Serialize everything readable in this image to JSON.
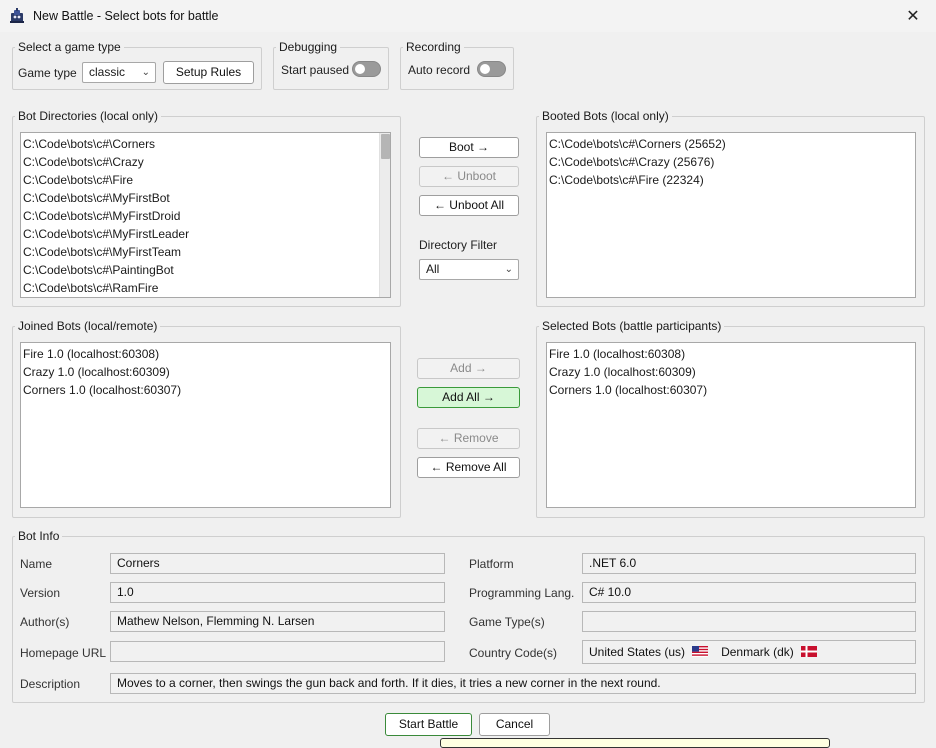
{
  "window": {
    "title": "New Battle - Select bots for battle",
    "icon": "robot-tank-icon",
    "close_icon": "close-icon"
  },
  "game_type": {
    "legend": "Select a game type",
    "label": "Game type",
    "selected": "classic",
    "setup_rules": "Setup Rules"
  },
  "debugging": {
    "legend": "Debugging",
    "label": "Start paused",
    "on": false
  },
  "recording": {
    "legend": "Recording",
    "label": "Auto record",
    "on": false
  },
  "bot_directories": {
    "legend": "Bot Directories (local only)",
    "items": [
      "C:\\Code\\bots\\c#\\Corners",
      "C:\\Code\\bots\\c#\\Crazy",
      "C:\\Code\\bots\\c#\\Fire",
      "C:\\Code\\bots\\c#\\MyFirstBot",
      "C:\\Code\\bots\\c#\\MyFirstDroid",
      "C:\\Code\\bots\\c#\\MyFirstLeader",
      "C:\\Code\\bots\\c#\\MyFirstTeam",
      "C:\\Code\\bots\\c#\\PaintingBot",
      "C:\\Code\\bots\\c#\\RamFire"
    ]
  },
  "boot_controls": {
    "boot": "Boot →",
    "unboot": "← Unboot",
    "unboot_all": "← Unboot All",
    "filter_label": "Directory Filter",
    "filter_selected": "All"
  },
  "booted_bots": {
    "legend": "Booted Bots (local only)",
    "items": [
      "C:\\Code\\bots\\c#\\Corners (25652)",
      "C:\\Code\\bots\\c#\\Crazy (25676)",
      "C:\\Code\\bots\\c#\\Fire (22324)"
    ]
  },
  "joined_bots": {
    "legend": "Joined Bots (local/remote)",
    "items": [
      "Fire 1.0 (localhost:60308)",
      "Crazy 1.0 (localhost:60309)",
      "Corners 1.0 (localhost:60307)"
    ]
  },
  "add_controls": {
    "add": "Add →",
    "add_all": "Add All →",
    "remove": "← Remove",
    "remove_all": "← Remove All"
  },
  "selected_bots": {
    "legend": "Selected Bots (battle participants)",
    "items": [
      "Fire 1.0 (localhost:60308)",
      "Crazy 1.0 (localhost:60309)",
      "Corners 1.0 (localhost:60307)"
    ]
  },
  "bot_info": {
    "legend": "Bot Info",
    "name_label": "Name",
    "name": "Corners",
    "version_label": "Version",
    "version": "1.0",
    "authors_label": "Author(s)",
    "authors": "Mathew Nelson, Flemming N. Larsen",
    "homepage_label": "Homepage URL",
    "homepage": "",
    "platform_label": "Platform",
    "platform": ".NET 6.0",
    "lang_label": "Programming Lang.",
    "lang": "C# 10.0",
    "game_types_label": "Game Type(s)",
    "game_types": "",
    "country_label": "Country Code(s)",
    "country_us": "United States (us)",
    "country_dk": "Denmark (dk)",
    "description_label": "Description",
    "description": "Moves to a corner, then swings the gun back and forth. If it dies, it tries a new corner in the next round."
  },
  "footer": {
    "start": "Start Battle",
    "cancel": "Cancel"
  },
  "colors": {
    "window_bg": "#f0f0f0",
    "add_all_bg": "#d7f7d7",
    "add_all_border": "#3a9a3a",
    "toggle_off": "#9a9a9a"
  }
}
